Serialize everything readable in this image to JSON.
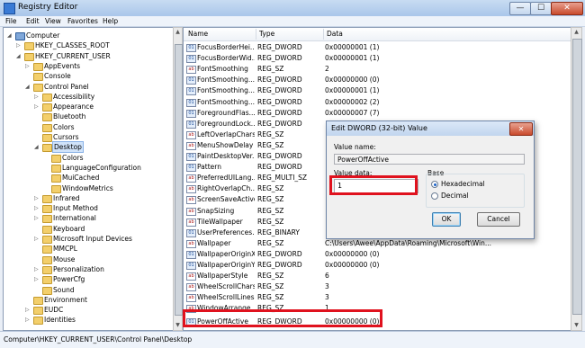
{
  "window": {
    "title": "Registry Editor",
    "min": "—",
    "max": "☐",
    "close": "✕"
  },
  "menu": [
    "File",
    "Edit",
    "View",
    "Favorites",
    "Help"
  ],
  "tree": [
    {
      "label": "Computer",
      "depth": 0,
      "tw": "◢"
    },
    {
      "label": "HKEY_CLASSES_ROOT",
      "depth": 1,
      "tw": "▷"
    },
    {
      "label": "HKEY_CURRENT_USER",
      "depth": 1,
      "tw": "◢"
    },
    {
      "label": "AppEvents",
      "depth": 2,
      "tw": "▷"
    },
    {
      "label": "Console",
      "depth": 2,
      "tw": ""
    },
    {
      "label": "Control Panel",
      "depth": 2,
      "tw": "◢"
    },
    {
      "label": "Accessibility",
      "depth": 3,
      "tw": "▷"
    },
    {
      "label": "Appearance",
      "depth": 3,
      "tw": "▷"
    },
    {
      "label": "Bluetooth",
      "depth": 3,
      "tw": ""
    },
    {
      "label": "Colors",
      "depth": 3,
      "tw": ""
    },
    {
      "label": "Cursors",
      "depth": 3,
      "tw": ""
    },
    {
      "label": "Desktop",
      "depth": 3,
      "tw": "◢",
      "selected": true
    },
    {
      "label": "Colors",
      "depth": 4,
      "tw": ""
    },
    {
      "label": "LanguageConfiguration",
      "depth": 4,
      "tw": ""
    },
    {
      "label": "MuiCached",
      "depth": 4,
      "tw": ""
    },
    {
      "label": "WindowMetrics",
      "depth": 4,
      "tw": ""
    },
    {
      "label": "Infrared",
      "depth": 3,
      "tw": "▷"
    },
    {
      "label": "Input Method",
      "depth": 3,
      "tw": "▷"
    },
    {
      "label": "International",
      "depth": 3,
      "tw": "▷"
    },
    {
      "label": "Keyboard",
      "depth": 3,
      "tw": ""
    },
    {
      "label": "Microsoft Input Devices",
      "depth": 3,
      "tw": "▷"
    },
    {
      "label": "MMCPL",
      "depth": 3,
      "tw": ""
    },
    {
      "label": "Mouse",
      "depth": 3,
      "tw": ""
    },
    {
      "label": "Personalization",
      "depth": 3,
      "tw": "▷"
    },
    {
      "label": "PowerCfg",
      "depth": 3,
      "tw": "▷"
    },
    {
      "label": "Sound",
      "depth": 3,
      "tw": ""
    },
    {
      "label": "Environment",
      "depth": 2,
      "tw": ""
    },
    {
      "label": "EUDC",
      "depth": 2,
      "tw": "▷"
    },
    {
      "label": "Identities",
      "depth": 2,
      "tw": "▷"
    }
  ],
  "list": {
    "headers": {
      "name": "Name",
      "type": "Type",
      "data": "Data"
    },
    "rows": [
      {
        "name": "FocusBorderHei...",
        "type": "REG_DWORD",
        "data": "0x00000001 (1)",
        "icon": "bin"
      },
      {
        "name": "FocusBorderWid...",
        "type": "REG_DWORD",
        "data": "0x00000001 (1)",
        "icon": "bin"
      },
      {
        "name": "FontSmoothing",
        "type": "REG_SZ",
        "data": "2",
        "icon": "sz"
      },
      {
        "name": "FontSmoothing...",
        "type": "REG_DWORD",
        "data": "0x00000000 (0)",
        "icon": "bin"
      },
      {
        "name": "FontSmoothing...",
        "type": "REG_DWORD",
        "data": "0x00000001 (1)",
        "icon": "bin"
      },
      {
        "name": "FontSmoothing...",
        "type": "REG_DWORD",
        "data": "0x00000002 (2)",
        "icon": "bin"
      },
      {
        "name": "ForegroundFlas...",
        "type": "REG_DWORD",
        "data": "0x00000007 (7)",
        "icon": "bin"
      },
      {
        "name": "ForegroundLock...",
        "type": "REG_DWORD",
        "data": "",
        "icon": "bin"
      },
      {
        "name": "LeftOverlapChars",
        "type": "REG_SZ",
        "data": "",
        "icon": "sz"
      },
      {
        "name": "MenuShowDelay",
        "type": "REG_SZ",
        "data": "",
        "icon": "sz"
      },
      {
        "name": "PaintDesktopVer...",
        "type": "REG_DWORD",
        "data": "",
        "icon": "bin"
      },
      {
        "name": "Pattern",
        "type": "REG_DWORD",
        "data": "",
        "icon": "bin"
      },
      {
        "name": "PreferredUILang...",
        "type": "REG_MULTI_SZ",
        "data": "",
        "icon": "sz"
      },
      {
        "name": "RightOverlapCh...",
        "type": "REG_SZ",
        "data": "",
        "icon": "sz"
      },
      {
        "name": "ScreenSaveActive",
        "type": "REG_SZ",
        "data": "",
        "icon": "sz"
      },
      {
        "name": "SnapSizing",
        "type": "REG_SZ",
        "data": "",
        "icon": "sz"
      },
      {
        "name": "TileWallpaper",
        "type": "REG_SZ",
        "data": "",
        "icon": "sz"
      },
      {
        "name": "UserPreferences...",
        "type": "REG_BINARY",
        "data": "",
        "icon": "bin"
      },
      {
        "name": "Wallpaper",
        "type": "REG_SZ",
        "data": "C:\\Users\\Awee\\AppData\\Roaming\\Microsoft\\Win...",
        "icon": "sz"
      },
      {
        "name": "WallpaperOriginX",
        "type": "REG_DWORD",
        "data": "0x00000000 (0)",
        "icon": "bin"
      },
      {
        "name": "WallpaperOriginY",
        "type": "REG_DWORD",
        "data": "0x00000000 (0)",
        "icon": "bin"
      },
      {
        "name": "WallpaperStyle",
        "type": "REG_SZ",
        "data": "6",
        "icon": "sz"
      },
      {
        "name": "WheelScrollChars",
        "type": "REG_SZ",
        "data": "3",
        "icon": "sz"
      },
      {
        "name": "WheelScrollLines",
        "type": "REG_SZ",
        "data": "3",
        "icon": "sz"
      },
      {
        "name": "WindowArrange...",
        "type": "REG_SZ",
        "data": "1",
        "icon": "sz"
      },
      {
        "name": "PowerOffActive",
        "type": "REG_DWORD",
        "data": "0x00000000 (0)",
        "icon": "bin"
      }
    ]
  },
  "status": "Computer\\HKEY_CURRENT_USER\\Control Panel\\Desktop",
  "dialog": {
    "title": "Edit DWORD (32-bit) Value",
    "close": "✕",
    "value_name_label": "Value name:",
    "value_name": "PowerOffActive",
    "value_data_label": "Value data:",
    "value_data": "1",
    "base_label": "Base",
    "hex_label": "Hexadecimal",
    "dec_label": "Decimal",
    "ok": "OK",
    "cancel": "Cancel"
  },
  "colors": {
    "highlight": "#e0121e",
    "selection": "#d0e3fa"
  }
}
